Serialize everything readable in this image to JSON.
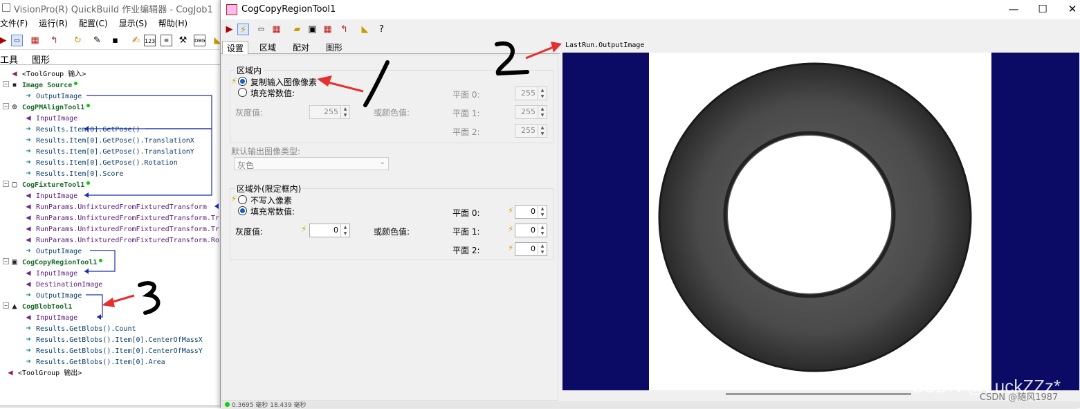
{
  "left_window": {
    "title": "VisionPro(R) QuickBuild 作业编辑器 - CogJob1",
    "menu": [
      "文件(F)",
      "运行(R)",
      "配置(C)",
      "显示(S)",
      "帮助(H)"
    ],
    "tabs": [
      "工具",
      "图形"
    ],
    "tree": [
      {
        "text": "<ToolGroup 输入>",
        "kind": "group"
      },
      {
        "text": "Image Source",
        "kind": "tool"
      },
      {
        "text": "OutputImage",
        "kind": "out"
      },
      {
        "text": "CogPMAlignTool1",
        "kind": "tool"
      },
      {
        "text": "InputImage",
        "kind": "in"
      },
      {
        "text": "Results.Item[0].GetPose()",
        "kind": "out"
      },
      {
        "text": "Results.Item[0].GetPose().TranslationX",
        "kind": "out"
      },
      {
        "text": "Results.Item[0].GetPose().TranslationY",
        "kind": "out"
      },
      {
        "text": "Results.Item[0].GetPose().Rotation",
        "kind": "out"
      },
      {
        "text": "Results.Item[0].Score",
        "kind": "out"
      },
      {
        "text": "CogFixtureTool1",
        "kind": "tool"
      },
      {
        "text": "InputImage",
        "kind": "in"
      },
      {
        "text": "RunParams.UnfixturedFromFixturedTransform",
        "kind": "in"
      },
      {
        "text": "RunParams.UnfixturedFromFixturedTransform.Tr",
        "kind": "in"
      },
      {
        "text": "RunParams.UnfixturedFromFixturedTransform.Tr",
        "kind": "in"
      },
      {
        "text": "RunParams.UnfixturedFromFixturedTransform.Ro",
        "kind": "in"
      },
      {
        "text": "OutputImage",
        "kind": "out"
      },
      {
        "text": "CogCopyRegionTool1",
        "kind": "tool"
      },
      {
        "text": "InputImage",
        "kind": "in"
      },
      {
        "text": "DestinationImage",
        "kind": "in"
      },
      {
        "text": "OutputImage",
        "kind": "out"
      },
      {
        "text": "CogBlobTool1",
        "kind": "tool"
      },
      {
        "text": "InputImage",
        "kind": "in"
      },
      {
        "text": "Results.GetBlobs().Count",
        "kind": "out"
      },
      {
        "text": "Results.GetBlobs().Item[0].CenterOfMassX",
        "kind": "out"
      },
      {
        "text": "Results.GetBlobs().Item[0].CenterOfMassY",
        "kind": "out"
      },
      {
        "text": "Results.GetBlobs().Item[0].Area",
        "kind": "out"
      },
      {
        "text": "<ToolGroup 输出>",
        "kind": "group"
      }
    ]
  },
  "dialog": {
    "title": "CogCopyRegionTool1",
    "tabs": [
      "设置",
      "区域",
      "配对",
      "图形"
    ],
    "inside_group": {
      "title": "区域内",
      "radio_copy": "复制输入图像像素",
      "radio_fill": "填充常数值:",
      "gray_label": "灰度值:",
      "gray_value": "255",
      "color_label": "或颜色值:",
      "planes": [
        {
          "label": "平面 0:",
          "value": "255"
        },
        {
          "label": "平面 1:",
          "value": "255"
        },
        {
          "label": "平面 2:",
          "value": "255"
        }
      ]
    },
    "default_type_label": "默认输出图像类型:",
    "default_type_value": "灰色",
    "outside_group": {
      "title": "区域外(限定框内)",
      "radio_nowrite": "不写入像素",
      "radio_fill": "填充常数值:",
      "gray_label": "灰度值:",
      "gray_value": "0",
      "color_label": "或颜色值:",
      "planes": [
        {
          "label": "平面 0:",
          "value": "0"
        },
        {
          "label": "平面 1:",
          "value": "0"
        },
        {
          "label": "平面 2:",
          "value": "0"
        }
      ]
    },
    "image_header": "LastRun.OutputImage",
    "status": "0.3695 毫秒 18.439 毫秒"
  },
  "annotations": [
    "1",
    "2",
    "3"
  ],
  "watermark": {
    "big": "CSDN @LuckZZz*",
    "small": "CSDN @随风1987"
  },
  "colors": {
    "image_bg": "#0b0b66",
    "arrow": "#e53030",
    "link": "#1a2fb0"
  }
}
